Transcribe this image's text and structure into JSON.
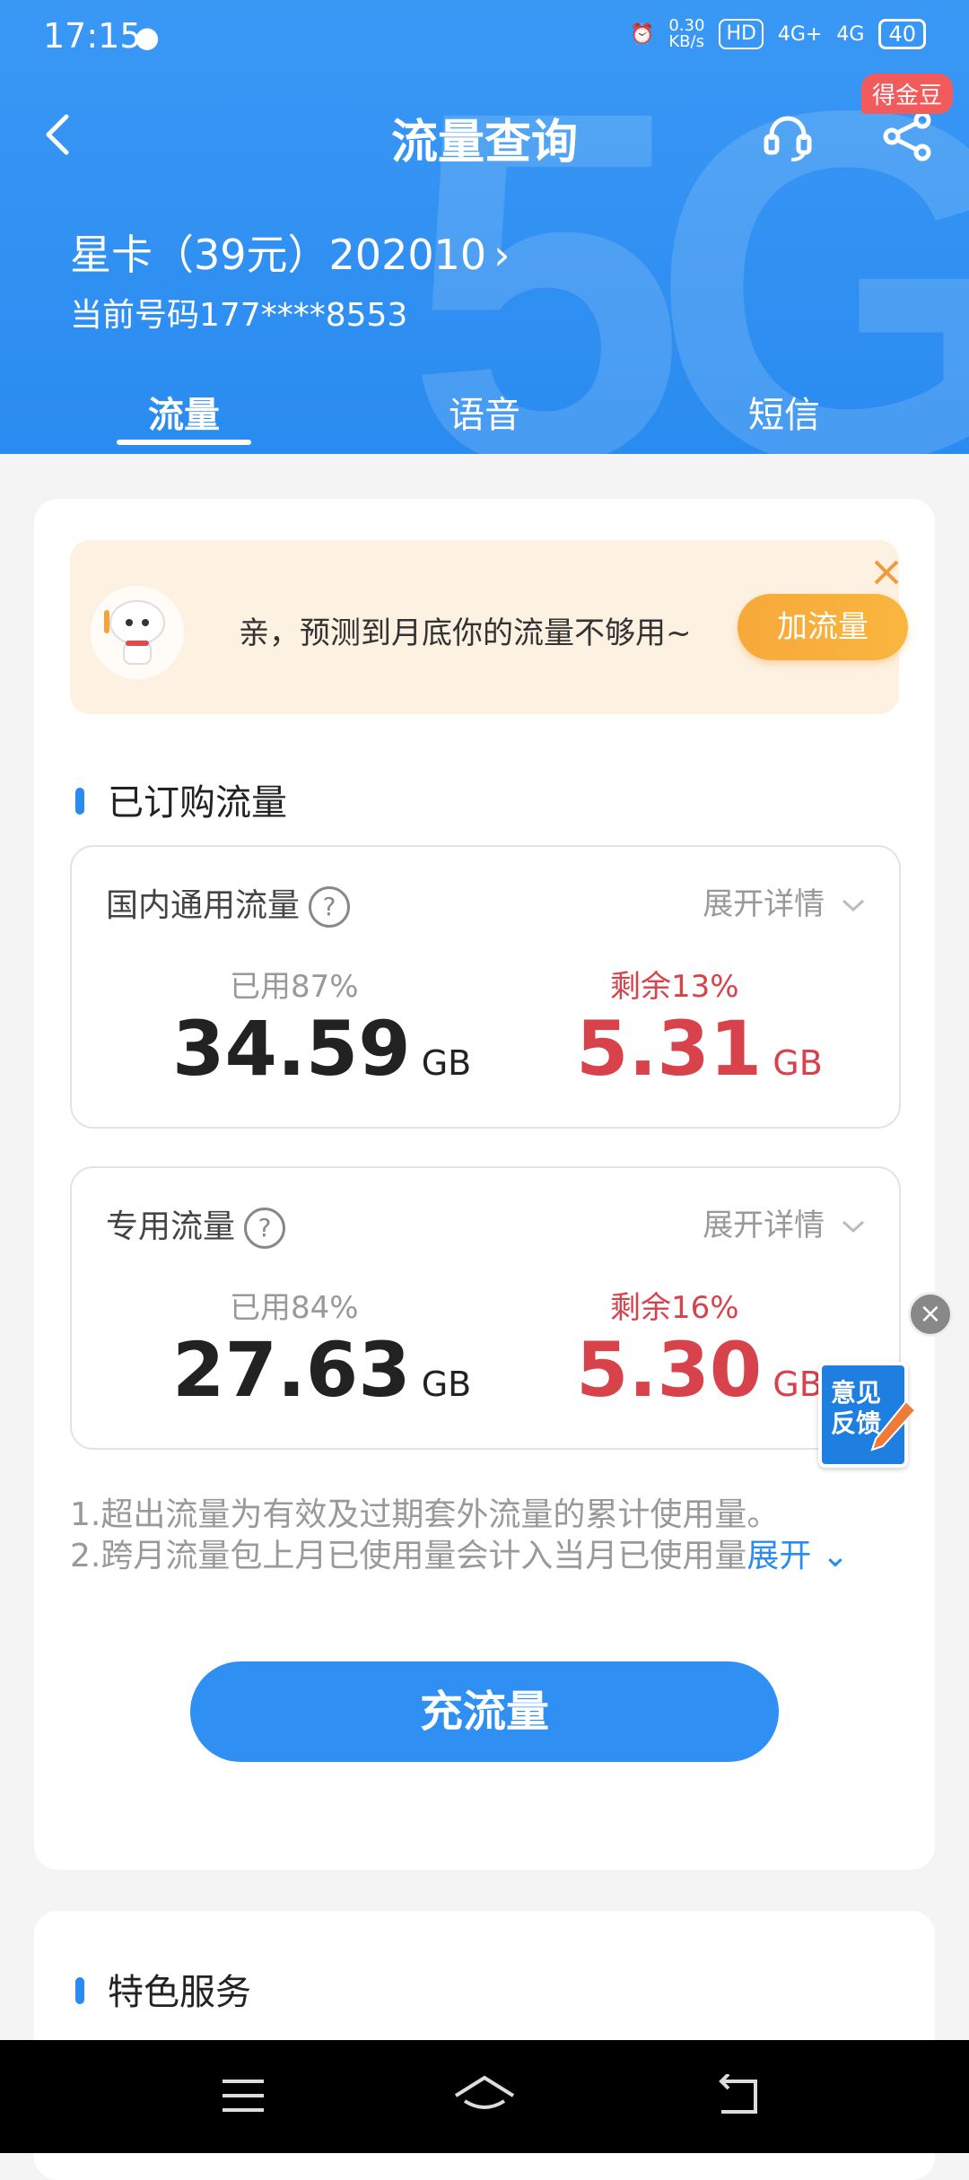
{
  "status": {
    "time": "17:15",
    "net_speed_top": "0.30",
    "net_speed_bottom": "KB/s",
    "hd": "HD",
    "net1": "4G+",
    "net2": "4G",
    "battery": "40"
  },
  "nav": {
    "title": "流量查询",
    "badge": "得金豆"
  },
  "plan": {
    "name": "星卡（39元）202010",
    "number_label": "当前号码177****8553"
  },
  "tabs": [
    "流量",
    "语音",
    "短信"
  ],
  "notice": {
    "text": "亲，预测到月底你的流量不够用~",
    "button": "加流量"
  },
  "section": {
    "subscribed": "已订购流量",
    "features": "特色服务"
  },
  "usage": [
    {
      "name": "国内通用流量",
      "expand": "展开详情",
      "used_label": "已用87%",
      "used_value": "34.59",
      "remain_label": "剩余13%",
      "remain_value": "5.31",
      "unit": "GB"
    },
    {
      "name": "专用流量",
      "expand": "展开详情",
      "used_label": "已用84%",
      "used_value": "27.63",
      "remain_label": "剩余16%",
      "remain_value": "5.30",
      "unit": "GB"
    }
  ],
  "notes": {
    "line1": "1.超出流量为有效及过期套外流量的累计使用量。",
    "line2": "2.跨月流量包上月已使用量会计入当月已使用量",
    "expand": "展开"
  },
  "charge_button": "充流量",
  "feedback": {
    "line1": "意见",
    "line2": "反馈"
  },
  "colors": {
    "primary": "#2a8bf0",
    "remain": "#d8434b",
    "notice_bg": "#fdf1e2",
    "notice_btn": "#f7a93a"
  }
}
